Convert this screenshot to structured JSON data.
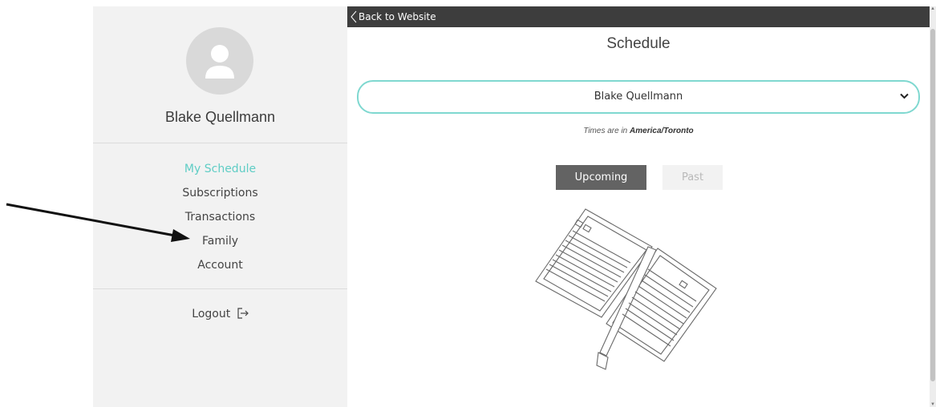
{
  "topbar": {
    "back_label": "Back to Website"
  },
  "sidebar": {
    "user_name": "Blake Quellmann",
    "items": [
      {
        "label": "My Schedule",
        "active": true
      },
      {
        "label": "Subscriptions",
        "active": false
      },
      {
        "label": "Transactions",
        "active": false
      },
      {
        "label": "Family",
        "active": false
      },
      {
        "label": "Account",
        "active": false
      }
    ],
    "logout_label": "Logout"
  },
  "main": {
    "title": "Schedule",
    "selected_person": "Blake Quellmann",
    "timezone_prefix": "Times are in ",
    "timezone": "America/Toronto",
    "tabs": [
      {
        "label": "Upcoming",
        "active": true
      },
      {
        "label": "Past",
        "active": false
      }
    ]
  },
  "colors": {
    "accent": "#5fcdc5",
    "select_border": "#7fd8d0",
    "topbar": "#3d3d3d",
    "sidebar_bg": "#f2f2f2",
    "active_tab": "#636363"
  },
  "icons": {
    "avatar": "user-silhouette-icon",
    "back": "chevron-left-icon",
    "select": "chevron-down-icon",
    "logout": "logout-icon",
    "illustration": "open-planner-book-icon",
    "annotation": "arrow-pointer-icon"
  }
}
